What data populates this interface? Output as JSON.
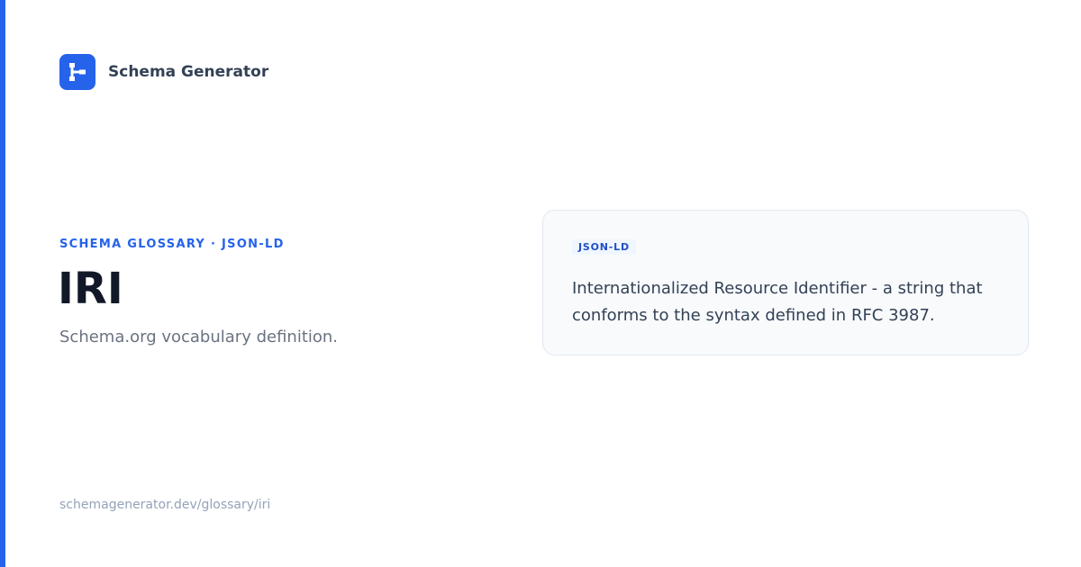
{
  "brand": {
    "name": "Schema Generator",
    "icon": "schema-tree-icon",
    "accent_color": "#2563eb"
  },
  "hero": {
    "kicker": "SCHEMA GLOSSARY · JSON-LD",
    "title": "IRI",
    "subtitle": "Schema.org vocabulary definition."
  },
  "definition_card": {
    "tag": "JSON-LD",
    "text": "Internationalized Resource Identifier - a string that conforms to the syntax defined in RFC 3987."
  },
  "footer": {
    "url": "schemagenerator.dev/glossary/iri"
  }
}
